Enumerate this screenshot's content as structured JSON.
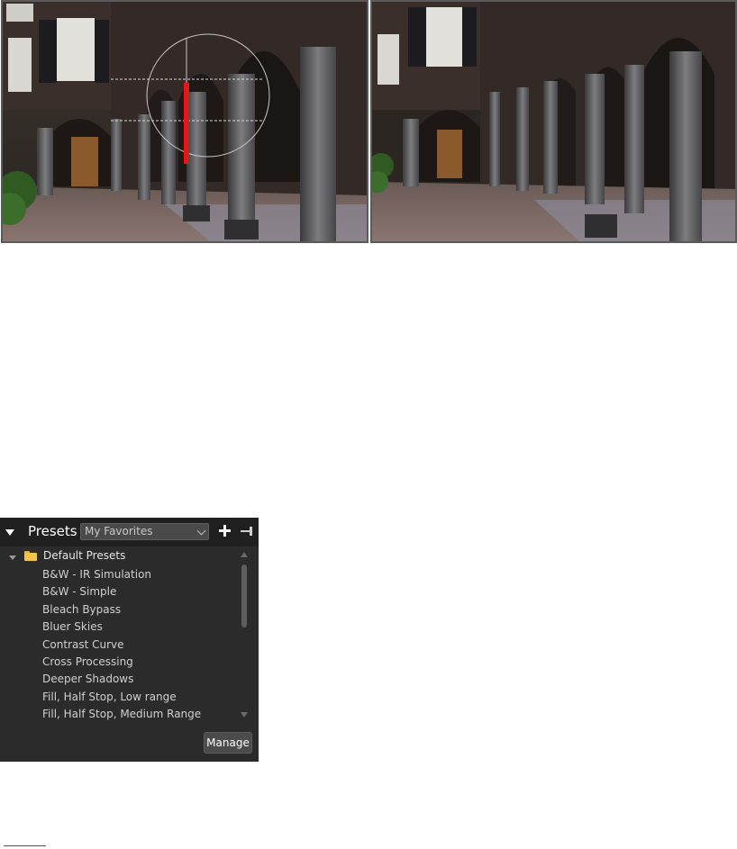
{
  "images": {
    "before": {
      "description_icon": "photo-with-perspective-guide"
    },
    "after": {
      "description_icon": "photo-corrected"
    }
  },
  "presets_panel": {
    "title": "Presets",
    "dropdown_value": "My Favorites",
    "add_icon": "plus-icon",
    "pin_icon": "pin-icon",
    "folder": {
      "label": "Default Presets",
      "icon": "folder-icon"
    },
    "items": [
      "B&W - IR Simulation",
      "B&W - Simple",
      "Bleach Bypass",
      "Bluer Skies",
      "Contrast Curve",
      "Cross Processing",
      "Deeper Shadows",
      "Fill, Half Stop, Low range",
      "Fill, Half Stop, Medium Range"
    ],
    "manage_label": "Manage"
  },
  "colors": {
    "panel_bg": "#2b2b2b",
    "header_bg": "#1f1f1f",
    "folder": "#f2c54a",
    "guide_line": "#e01818"
  }
}
